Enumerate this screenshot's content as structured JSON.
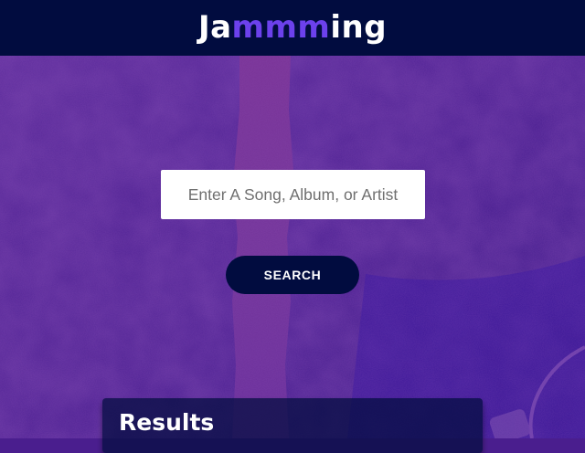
{
  "app": {
    "logo_parts": [
      "Ja",
      "mmm",
      "ing"
    ],
    "accent_color": "#6c41ec",
    "nav_color": "#010c3f"
  },
  "search": {
    "placeholder": "Enter A Song, Album, or Artist",
    "value": "",
    "button_label": "SEARCH"
  },
  "results": {
    "title": "Results"
  },
  "background": {
    "theme": "purple-tinted-photo",
    "base_color": "#4a1e8e"
  }
}
